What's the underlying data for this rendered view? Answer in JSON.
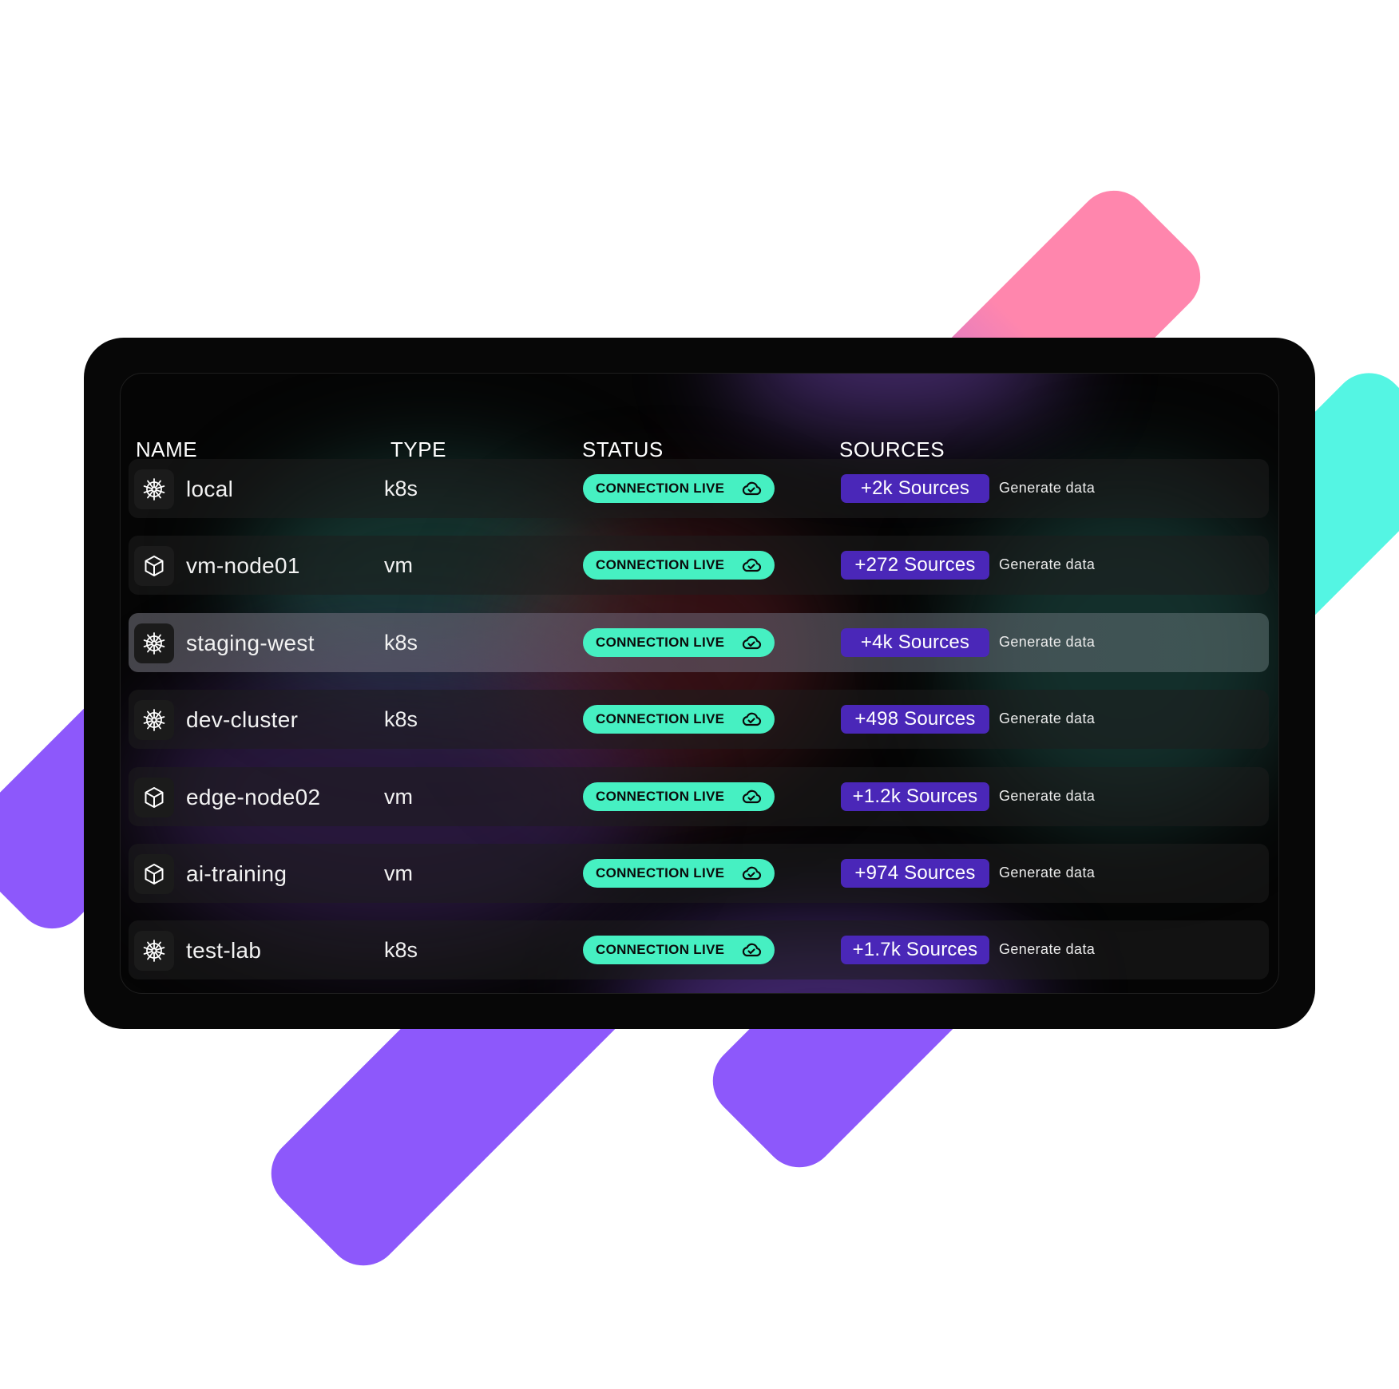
{
  "colors": {
    "accent_green": "#46f0c2",
    "accent_purple": "#4a27b8",
    "bar_purple": "#8d58fb",
    "bar_pink": "#ff86ad",
    "bar_cyan": "#54f5e3",
    "panel": "#070707"
  },
  "table": {
    "headers": {
      "name": "NAME",
      "type": "TYPE",
      "status": "STATUS",
      "sources": "SOURCES"
    },
    "rows": [
      {
        "icon": "kubernetes-icon",
        "name": "local",
        "type": "k8s",
        "status": "CONNECTION LIVE",
        "sources": "+2k Sources",
        "action": "Generate data"
      },
      {
        "icon": "cube-icon",
        "name": "vm-node01",
        "type": "vm",
        "status": "CONNECTION LIVE",
        "sources": "+272 Sources",
        "action": "Generate data"
      },
      {
        "icon": "kubernetes-icon",
        "name": "staging-west",
        "type": "k8s",
        "status": "CONNECTION LIVE",
        "sources": "+4k Sources",
        "action": "Generate data"
      },
      {
        "icon": "kubernetes-icon",
        "name": "dev-cluster",
        "type": "k8s",
        "status": "CONNECTION LIVE",
        "sources": "+498 Sources",
        "action": "Generate data"
      },
      {
        "icon": "cube-icon",
        "name": "edge-node02",
        "type": "vm",
        "status": "CONNECTION LIVE",
        "sources": "+1.2k Sources",
        "action": "Generate data"
      },
      {
        "icon": "cube-icon",
        "name": "ai-training",
        "type": "vm",
        "status": "CONNECTION LIVE",
        "sources": "+974 Sources",
        "action": "Generate data"
      },
      {
        "icon": "kubernetes-icon",
        "name": "test-lab",
        "type": "k8s",
        "status": "CONNECTION LIVE",
        "sources": "+1.7k Sources",
        "action": "Generate data"
      }
    ],
    "highlighted_row": 2
  }
}
